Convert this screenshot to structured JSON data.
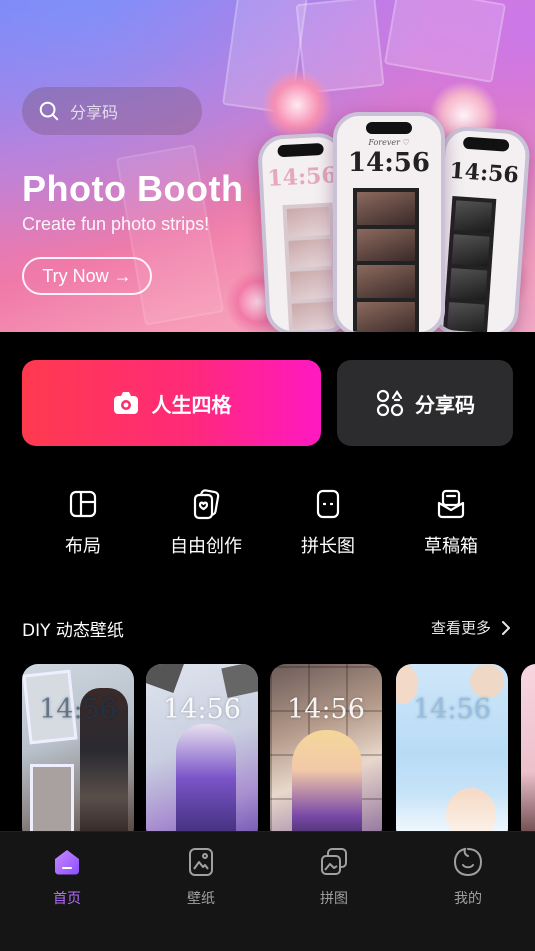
{
  "banner": {
    "search_placeholder": "分享码",
    "title": "Photo Booth",
    "subtitle": "Create fun photo strips!",
    "cta": "Try Now →",
    "phone_time": "14:56"
  },
  "actions": {
    "primary": "人生四格",
    "secondary": "分享码"
  },
  "tools": [
    {
      "label": "布局",
      "icon": "layout-icon"
    },
    {
      "label": "自由创作",
      "icon": "cards-icon"
    },
    {
      "label": "拼长图",
      "icon": "long-image-icon"
    },
    {
      "label": "草稿箱",
      "icon": "drafts-icon"
    }
  ],
  "section": {
    "title": "DIY 动态壁纸",
    "more": "查看更多"
  },
  "wallpapers": [
    {
      "time": "14:56"
    },
    {
      "time": "14:56"
    },
    {
      "time": "14:56"
    },
    {
      "time": "14:56"
    }
  ],
  "nav": [
    {
      "label": "首页",
      "active": true
    },
    {
      "label": "壁纸",
      "active": false
    },
    {
      "label": "拼图",
      "active": false
    },
    {
      "label": "我的",
      "active": false
    }
  ],
  "colors": {
    "accent_purple": "#b56cff",
    "primary_gradient_start": "#ff3a4e",
    "primary_gradient_end": "#ff19c2",
    "secondary_button": "#2c2c2e",
    "background": "#000000"
  }
}
